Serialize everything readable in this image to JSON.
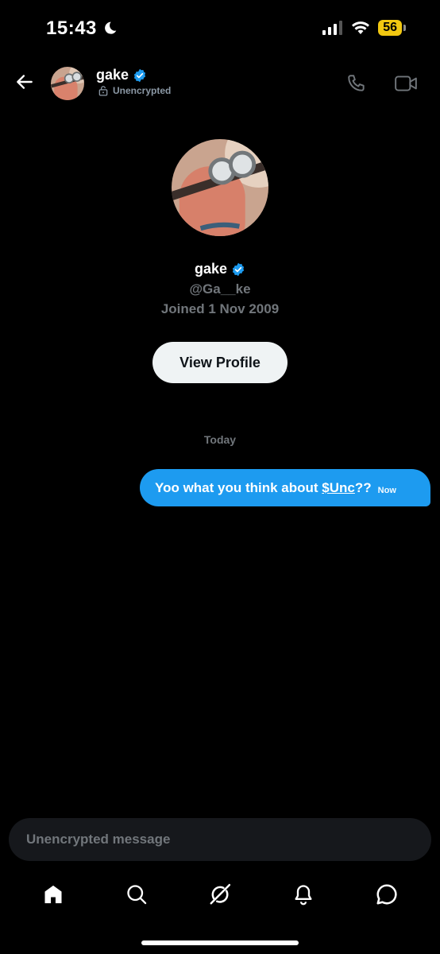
{
  "status_bar": {
    "time": "15:43",
    "battery": "56"
  },
  "header": {
    "name": "gake",
    "encryption_status": "Unencrypted"
  },
  "profile": {
    "name": "gake",
    "handle": "@Ga__ke",
    "joined": "Joined 1 Nov 2009",
    "view_profile_label": "View Profile"
  },
  "conversation": {
    "date_separator": "Today",
    "messages": [
      {
        "text_before": "Yoo what you think about ",
        "cashtag": "$Unc",
        "text_after": "??",
        "time": "Now"
      }
    ]
  },
  "composer": {
    "placeholder": "Unencrypted message"
  },
  "nav": [
    "home-icon",
    "search-icon",
    "grok-icon",
    "notifications-icon",
    "messages-icon"
  ],
  "colors": {
    "accent": "#1d9bf0",
    "background": "#000000",
    "battery": "#f2c811",
    "muted": "#71767b"
  }
}
